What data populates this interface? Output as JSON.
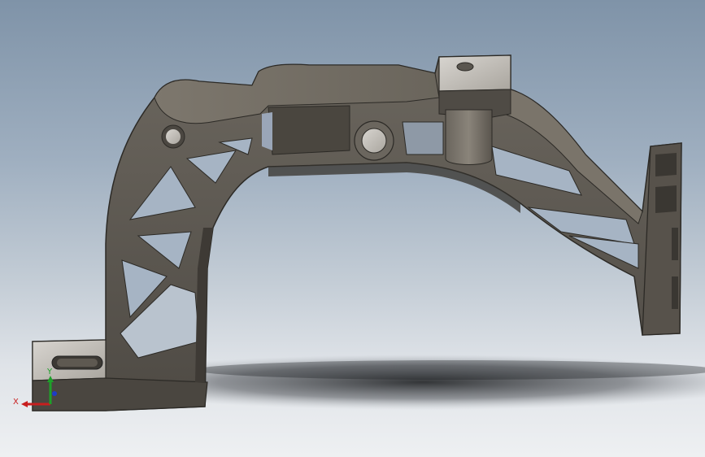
{
  "viewport": {
    "background_top": "#7f93a8",
    "background_bottom": "#eef0f2",
    "model_color": "#5a554e",
    "model_highlight": "#8a8478",
    "model_face_light": "#c9c6c0"
  },
  "triad": {
    "x_label": "X",
    "y_label": "Y",
    "x_color": "#c81e1e",
    "y_color": "#1ea02a",
    "z_color": "#1e3cc8"
  }
}
